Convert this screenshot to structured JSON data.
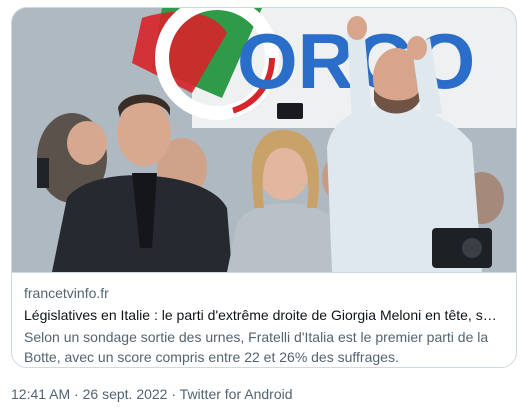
{
  "card": {
    "domain": "francetvinfo.fr",
    "title": "Législatives en Italie : le parti d'extrême droite de Giorgia Meloni en tête, sa co...",
    "description": "Selon un sondage sortie des urnes, Fratelli d'Italia est le premier parti de la Botte, avec un score compris entre 22 et 26% des suffrages."
  },
  "meta": {
    "time": "12:41 AM",
    "separator": " · ",
    "date": "26 sept. 2022",
    "source": "Twitter for Android"
  },
  "image": {
    "banner_text": "ORGO",
    "colors": {
      "green": "#2f9a48",
      "red": "#d8232a",
      "white": "#f4f4f4",
      "blue": "#2b6ec9"
    }
  }
}
